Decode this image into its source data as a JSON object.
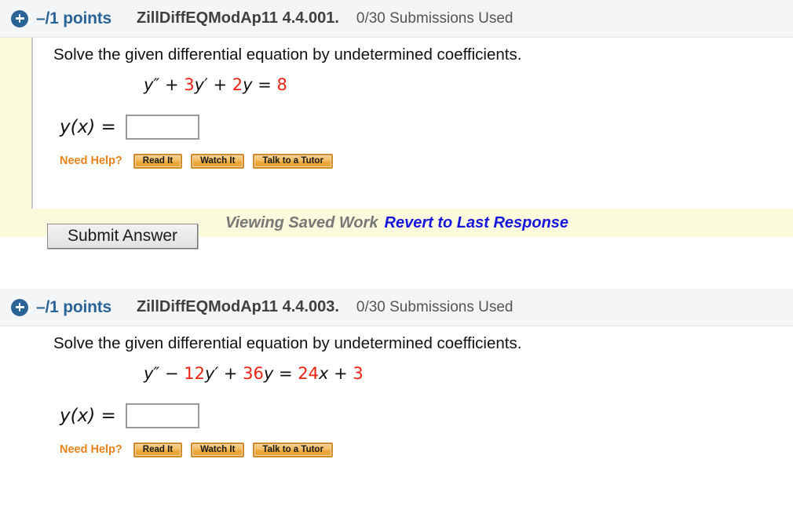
{
  "problems": [
    {
      "index": ".",
      "plus_icon": "plus-circle-icon",
      "points": "–/1 points",
      "code": "ZillDiffEQModAp11 4.4.001.",
      "submissions": "0/30 Submissions Used",
      "prompt": "Solve the given differential equation by undetermined coefficients.",
      "equation": {
        "parts": [
          {
            "text": "y″",
            "kind": "var"
          },
          {
            "text": " + ",
            "kind": "op"
          },
          {
            "text": "3",
            "kind": "num"
          },
          {
            "text": "y′",
            "kind": "var"
          },
          {
            "text": " + ",
            "kind": "op"
          },
          {
            "text": "2",
            "kind": "num"
          },
          {
            "text": "y",
            "kind": "var"
          },
          {
            "text": " = ",
            "kind": "op"
          },
          {
            "text": "8",
            "kind": "num"
          }
        ],
        "plain": "y″ + 3y′ + 2y = 8"
      },
      "answer_label": "y(x) =",
      "answer_value": "",
      "answer_placeholder": "",
      "help_label": "Need Help?",
      "help_buttons": [
        "Read It",
        "Watch It",
        "Talk to a Tutor"
      ]
    },
    {
      "index": ".",
      "plus_icon": "plus-circle-icon",
      "points": "–/1 points",
      "code": "ZillDiffEQModAp11 4.4.003.",
      "submissions": "0/30 Submissions Used",
      "prompt": "Solve the given differential equation by undetermined coefficients.",
      "equation": {
        "parts": [
          {
            "text": "y″",
            "kind": "var"
          },
          {
            "text": " − ",
            "kind": "op"
          },
          {
            "text": "12",
            "kind": "num"
          },
          {
            "text": "y′",
            "kind": "var"
          },
          {
            "text": " + ",
            "kind": "op"
          },
          {
            "text": "36",
            "kind": "num"
          },
          {
            "text": "y",
            "kind": "var"
          },
          {
            "text": " = ",
            "kind": "op"
          },
          {
            "text": "24",
            "kind": "num"
          },
          {
            "text": "x",
            "kind": "var"
          },
          {
            "text": " + ",
            "kind": "op"
          },
          {
            "text": "3",
            "kind": "num"
          }
        ],
        "plain": "y″ − 12y′ + 36y = 24x + 3"
      },
      "answer_label": "y(x) =",
      "answer_value": "",
      "answer_placeholder": "",
      "help_label": "Need Help?",
      "help_buttons": [
        "Read It",
        "Watch It",
        "Talk to a Tutor"
      ]
    }
  ],
  "saved_work": {
    "status_text": "Viewing Saved Work",
    "revert_label": "Revert to Last Response"
  },
  "submit": {
    "label": "Submit Answer"
  },
  "colors": {
    "accent_blue": "#2a6496",
    "link_blue": "#1515dd",
    "equation_red": "#ee2211",
    "help_orange": "#e8821a",
    "saved_band_yellow": "#fcfadd",
    "header_gray": "#f4f5f6"
  }
}
